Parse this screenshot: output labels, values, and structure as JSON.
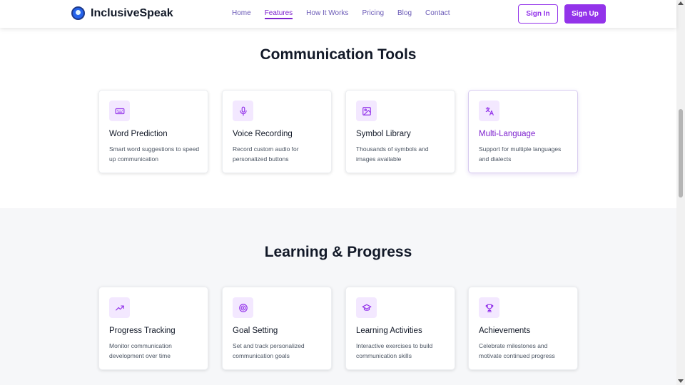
{
  "brand": {
    "name": "InclusiveSpeak"
  },
  "nav": {
    "links": [
      "Home",
      "Features",
      "How It Works",
      "Pricing",
      "Blog",
      "Contact"
    ],
    "active": "Features",
    "signin": "Sign In",
    "signup": "Sign Up"
  },
  "colors": {
    "accent": "#9333ea",
    "text": "#111827",
    "section_bg": "#f6f7f9"
  },
  "sections": [
    {
      "title": "Communication Tools",
      "cards": [
        {
          "icon": "keyboard-icon",
          "title": "Word Prediction",
          "desc": "Smart word suggestions to speed up communication"
        },
        {
          "icon": "microphone-icon",
          "title": "Voice Recording",
          "desc": "Record custom audio for personalized buttons"
        },
        {
          "icon": "image-icon",
          "title": "Symbol Library",
          "desc": "Thousands of symbols and images available"
        },
        {
          "icon": "translate-icon",
          "title": "Multi-Language",
          "desc": "Support for multiple languages and dialects"
        }
      ]
    },
    {
      "title": "Learning & Progress",
      "cards": [
        {
          "icon": "trending-up-icon",
          "title": "Progress Tracking",
          "desc": "Monitor communication development over time"
        },
        {
          "icon": "target-icon",
          "title": "Goal Setting",
          "desc": "Set and track personalized communication goals"
        },
        {
          "icon": "graduation-cap-icon",
          "title": "Learning Activities",
          "desc": "Interactive exercises to build communication skills"
        },
        {
          "icon": "trophy-icon",
          "title": "Achievements",
          "desc": "Celebrate milestones and motivate continued progress"
        }
      ]
    }
  ]
}
